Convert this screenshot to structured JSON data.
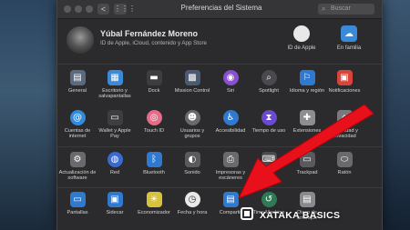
{
  "window": {
    "title": "Preferencias del Sistema",
    "search_placeholder": "Buscar",
    "back_glyph": "<",
    "forward_glyph": ">",
    "grid_glyph": "⋮⋮⋮"
  },
  "user": {
    "name": "Yúbal Fernández Moreno",
    "subtitle": "ID de Apple, iCloud, contenido y App Store",
    "top_items": [
      {
        "label": "ID de Apple",
        "icon": "apple-id-icon",
        "glyph": ""
      },
      {
        "label": "En familia",
        "icon": "family-sharing-icon",
        "glyph": "☁"
      }
    ]
  },
  "section1": [
    {
      "label": "General",
      "icon": "general-icon",
      "glyph": "▤",
      "color": "#5a6a80"
    },
    {
      "label": "Escritorio y salvapantallas",
      "icon": "desktop-icon",
      "glyph": "▦",
      "color": "#3a8ad8"
    },
    {
      "label": "Dock",
      "icon": "dock-icon",
      "glyph": "▬",
      "color": "#3d3d40"
    },
    {
      "label": "Mission Control",
      "icon": "mission-control-icon",
      "glyph": "▩",
      "color": "#4a5a70"
    },
    {
      "label": "Siri",
      "icon": "siri-icon",
      "glyph": "◉",
      "color": "#8a4ed0"
    },
    {
      "label": "Spotlight",
      "icon": "spotlight-icon",
      "glyph": "⌕",
      "color": "#4a4a4e"
    },
    {
      "label": "Idioma y región",
      "icon": "language-icon",
      "glyph": "⚐",
      "color": "#2f7ad0"
    },
    {
      "label": "Notificaciones",
      "icon": "notifications-icon",
      "glyph": "▣",
      "color": "#d8443a"
    },
    {
      "label": "Cuentas de internet",
      "icon": "internet-accounts-icon",
      "glyph": "@",
      "color": "#2f8ae0"
    },
    {
      "label": "Wallet y Apple Pay",
      "icon": "wallet-icon",
      "glyph": "▭",
      "color": "#3e3e40"
    },
    {
      "label": "Touch ID",
      "icon": "touch-id-icon",
      "glyph": "◎",
      "color": "#e86a86"
    },
    {
      "label": "Usuarios y grupos",
      "icon": "users-icon",
      "glyph": "☻",
      "color": "#6a6a6e"
    },
    {
      "label": "Accesibilidad",
      "icon": "accessibility-icon",
      "glyph": "♿",
      "color": "#2f7ad0"
    },
    {
      "label": "Tiempo de uso",
      "icon": "screen-time-icon",
      "glyph": "⧗",
      "color": "#6a4ad0"
    },
    {
      "label": "Extensiones",
      "icon": "extensions-icon",
      "glyph": "✚",
      "color": "#8e8e92"
    },
    {
      "label": "Seguridad y privacidad",
      "icon": "security-icon",
      "glyph": "⌂",
      "color": "#7a7a7e"
    }
  ],
  "section2": [
    {
      "label": "Actualización de software",
      "icon": "software-update-icon",
      "glyph": "⚙",
      "color": "#6a6a6e"
    },
    {
      "label": "Red",
      "icon": "network-icon",
      "glyph": "◍",
      "color": "#3a6ad0"
    },
    {
      "label": "Bluetooth",
      "icon": "bluetooth-icon",
      "glyph": "ᛒ",
      "color": "#2f7ad0"
    },
    {
      "label": "Sonido",
      "icon": "sound-icon",
      "glyph": "◐",
      "color": "#5a5a5e"
    },
    {
      "label": "Impresoras y escáneres",
      "icon": "printers-icon",
      "glyph": "⎙",
      "color": "#6a6a6e"
    },
    {
      "label": "",
      "icon": "keyboard-icon",
      "glyph": "⌨",
      "color": "#4a4a4e"
    },
    {
      "label": "Trackpad",
      "icon": "trackpad-icon",
      "glyph": "▭",
      "color": "#5a5a5e"
    },
    {
      "label": "Ratón",
      "icon": "mouse-icon",
      "glyph": "⬭",
      "color": "#6a6a6e"
    }
  ],
  "section3": [
    {
      "label": "Pantallas",
      "icon": "displays-icon",
      "glyph": "▭",
      "color": "#2f7ad0"
    },
    {
      "label": "Sidecar",
      "icon": "sidecar-icon",
      "glyph": "▣",
      "color": "#2f7ad0"
    },
    {
      "label": "Economizador",
      "icon": "energy-saver-icon",
      "glyph": "☀",
      "color": "#d8c23a"
    },
    {
      "label": "Fecha y hora",
      "icon": "date-time-icon",
      "glyph": "◷",
      "color": "#e8e8e8"
    },
    {
      "label": "Compartir",
      "icon": "sharing-icon",
      "glyph": "▤",
      "color": "#2f7ad0"
    },
    {
      "label": "Time Machine",
      "icon": "time-machine-icon",
      "glyph": "↺",
      "color": "#2e7a56"
    },
    {
      "label": "Disco de arranque",
      "icon": "startup-disk-icon",
      "glyph": "▤",
      "color": "#8a8a8e"
    }
  ],
  "watermark": "XATAKA BASICS",
  "colors": {
    "arrow": "#e8101a",
    "window_bg": "#2b2b2d"
  }
}
